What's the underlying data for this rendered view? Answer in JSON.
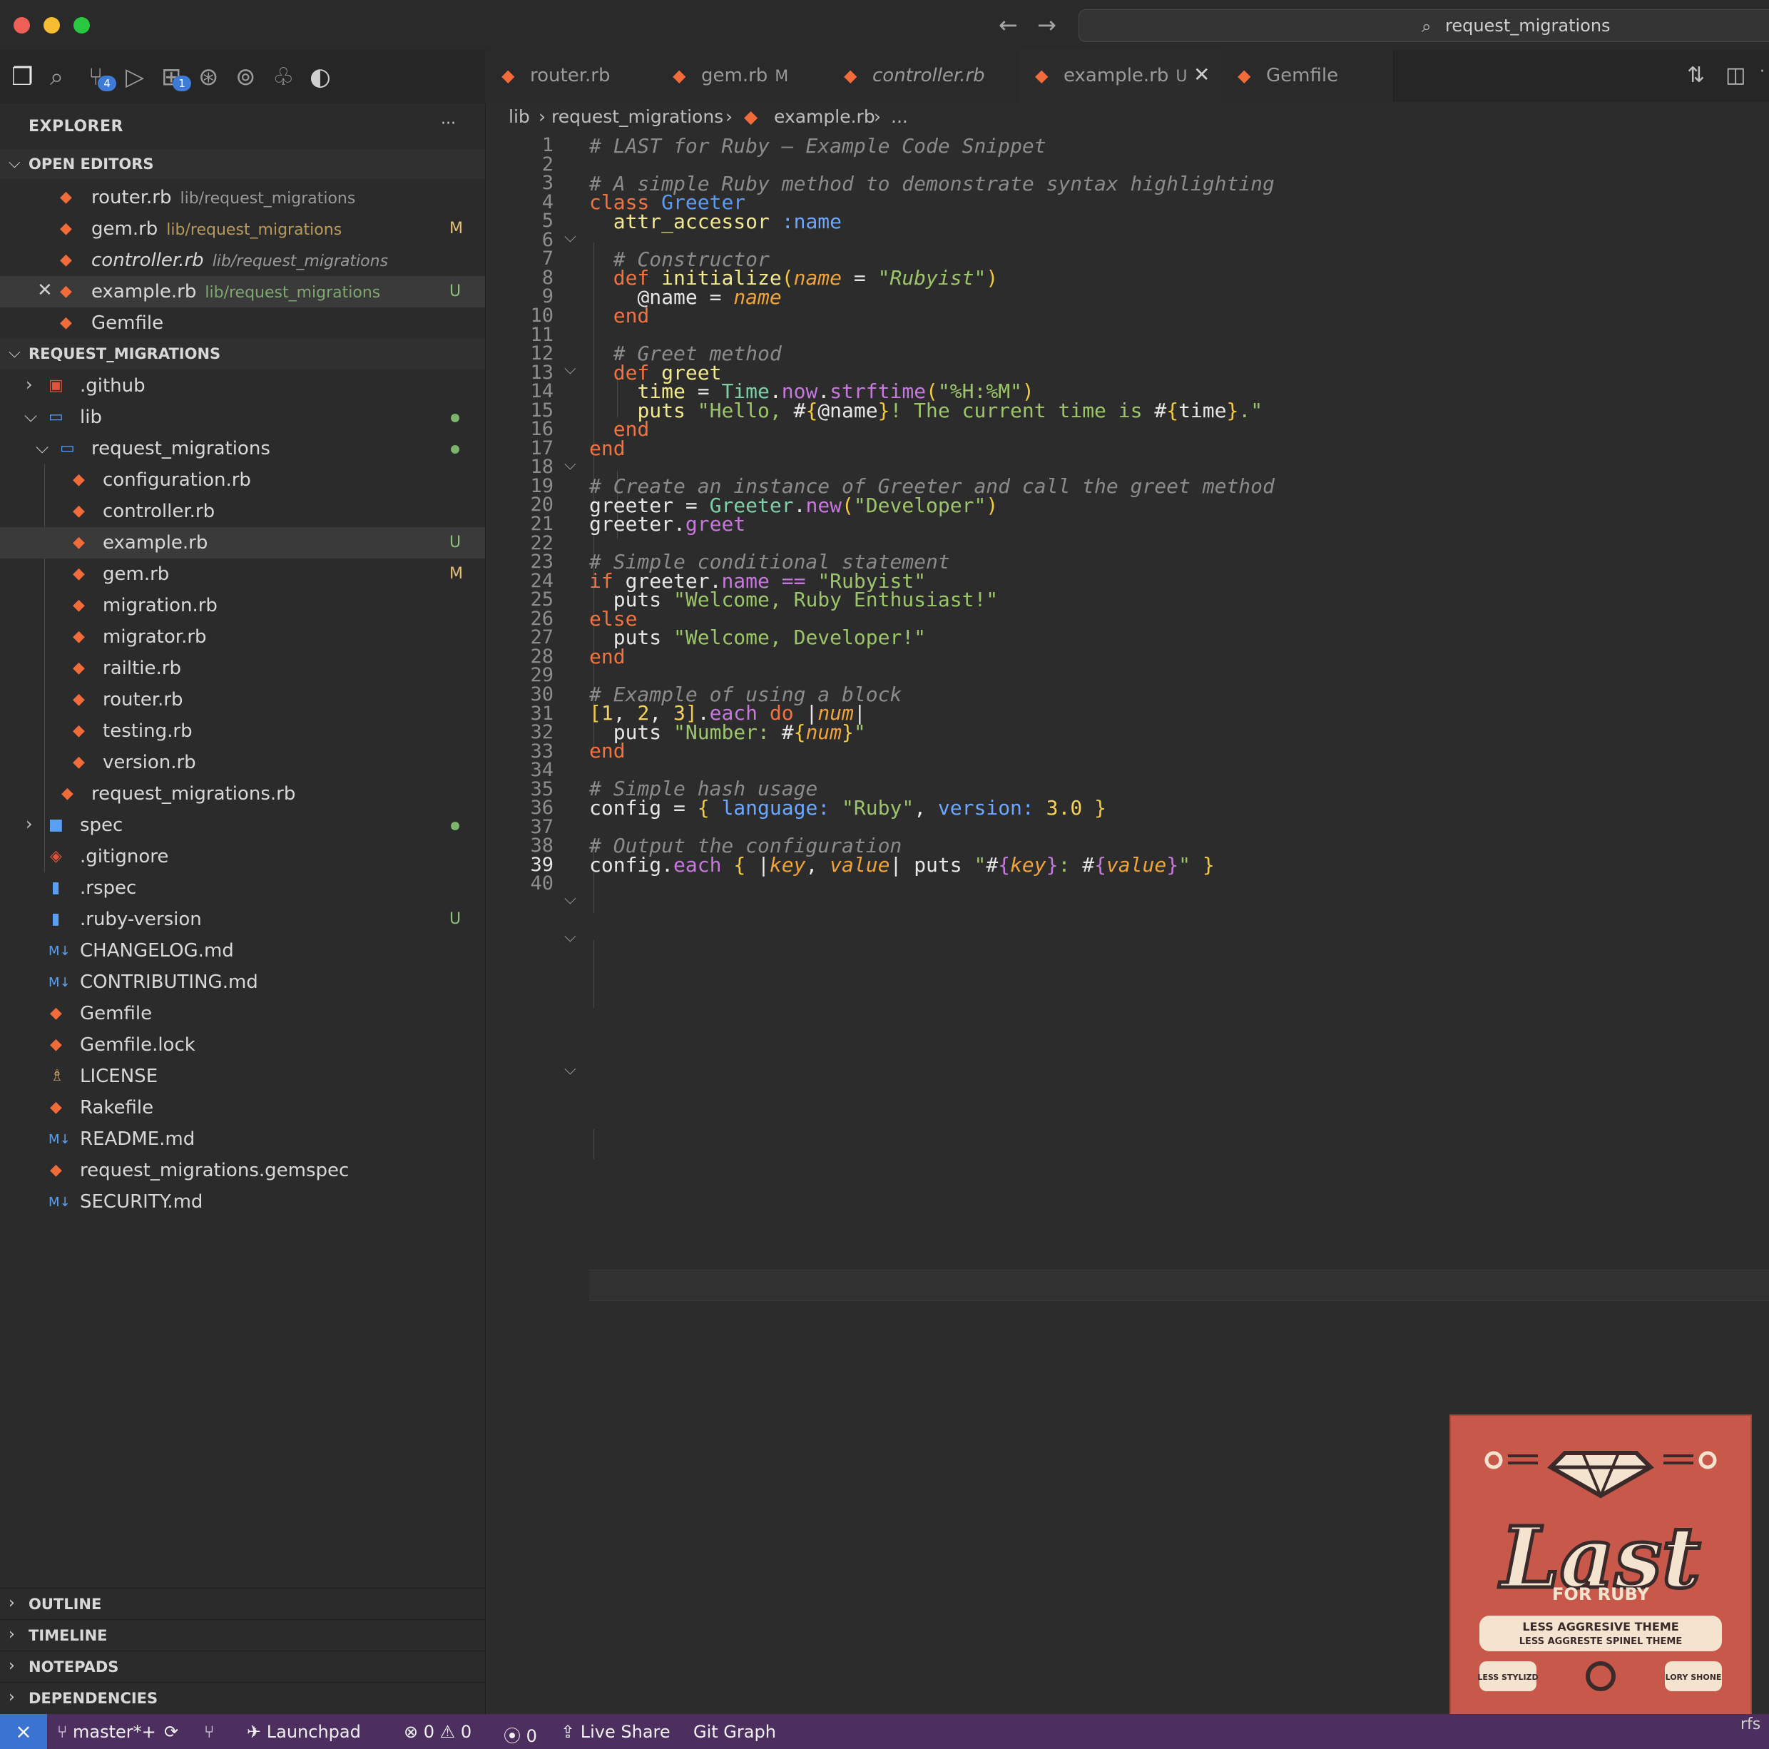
{
  "window": {
    "search_text": "request_migrations"
  },
  "activity": {
    "scm_badge": "4",
    "extensions_badge": "1"
  },
  "sidebar": {
    "title": "EXPLORER",
    "more": "···",
    "open_editors_title": "OPEN EDITORS",
    "open_editors": [
      {
        "name": "router.rb",
        "path": "lib/request_migrations",
        "status": ""
      },
      {
        "name": "gem.rb",
        "path": "lib/request_migrations",
        "status": "M"
      },
      {
        "name": "controller.rb",
        "path": "lib/request_migrations",
        "status": ""
      },
      {
        "name": "example.rb",
        "path": "lib/request_migrations",
        "status": "U"
      },
      {
        "name": "Gemfile",
        "path": "",
        "status": ""
      }
    ],
    "project_title": "REQUEST_MIGRATIONS",
    "tree": [
      {
        "name": ".github"
      },
      {
        "name": "lib"
      },
      {
        "name": "request_migrations"
      },
      {
        "name": "configuration.rb"
      },
      {
        "name": "controller.rb"
      },
      {
        "name": "example.rb",
        "status": "U"
      },
      {
        "name": "gem.rb",
        "status": "M"
      },
      {
        "name": "migration.rb"
      },
      {
        "name": "migrator.rb"
      },
      {
        "name": "railtie.rb"
      },
      {
        "name": "router.rb"
      },
      {
        "name": "testing.rb"
      },
      {
        "name": "version.rb"
      },
      {
        "name": "request_migrations.rb"
      },
      {
        "name": "spec"
      },
      {
        "name": ".gitignore"
      },
      {
        "name": ".rspec"
      },
      {
        "name": ".ruby-version",
        "status": "U"
      },
      {
        "name": "CHANGELOG.md"
      },
      {
        "name": "CONTRIBUTING.md"
      },
      {
        "name": "Gemfile"
      },
      {
        "name": "Gemfile.lock"
      },
      {
        "name": "LICENSE"
      },
      {
        "name": "Rakefile"
      },
      {
        "name": "README.md"
      },
      {
        "name": "request_migrations.gemspec"
      },
      {
        "name": "SECURITY.md"
      }
    ],
    "bottom_sections": [
      "OUTLINE",
      "TIMELINE",
      "NOTEPADS",
      "DEPENDENCIES"
    ]
  },
  "tabs": [
    {
      "label": "router.rb",
      "mark": ""
    },
    {
      "label": "gem.rb",
      "mark": "M"
    },
    {
      "label": "controller.rb",
      "mark": ""
    },
    {
      "label": "example.rb",
      "mark": "U"
    },
    {
      "label": "Gemfile",
      "mark": ""
    }
  ],
  "breadcrumb": [
    "lib",
    "request_migrations",
    "example.rb",
    "..."
  ],
  "editor": {
    "current_line": "39",
    "lines": [
      "1",
      "2",
      "3",
      "4",
      "5",
      "6",
      "7",
      "8",
      "9",
      "10",
      "11",
      "12",
      "13",
      "14",
      "15",
      "16",
      "17",
      "18",
      "19",
      "20",
      "21",
      "22",
      "23",
      "24",
      "25",
      "26",
      "27",
      "28",
      "29",
      "30",
      "31",
      "32",
      "33",
      "34",
      "35",
      "36",
      "37",
      "38",
      "39",
      "40"
    ],
    "code": {
      "l1": "# LAST for Ruby – Example Code Snippet",
      "l3": "# A simple Ruby method to demonstrate syntax highlighting",
      "l4a": "class",
      "l4b": "Greeter",
      "l5a": "attr_accessor",
      "l5b": ":name",
      "l7": "# Constructor",
      "l8a": "def",
      "l8b": "initialize",
      "l8c": "name",
      "l8d": "\"Rubyist\"",
      "l9a": "@name",
      "l9b": "name",
      "l10": "end",
      "l12": "# Greet method",
      "l13a": "def",
      "l13b": "greet",
      "l14a": "time",
      "l14b": "Time",
      "l14c": "now",
      "l14d": "strftime",
      "l14e": "\"%H:%M\"",
      "l15a": "puts",
      "l15b": "\"Hello, ",
      "l15c": "@name",
      "l15d": "! The current time is ",
      "l15e": "time",
      "l15f": ".\"",
      "l16": "end",
      "l17": "end",
      "l19": "# Create an instance of Greeter and call the greet method",
      "l20a": "greeter",
      "l20b": "Greeter",
      "l20c": "new",
      "l20d": "\"Developer\"",
      "l21a": "greeter",
      "l21b": "greet",
      "l23": "# Simple conditional statement",
      "l24a": "if",
      "l24b": "greeter",
      "l24c": "name",
      "l24d": "==",
      "l24e": "\"Rubyist\"",
      "l25a": "puts",
      "l25b": "\"Welcome, Ruby Enthusiast!\"",
      "l26": "else",
      "l27a": "puts",
      "l27b": "\"Welcome, Developer!\"",
      "l28": "end",
      "l30": "# Example of using a block",
      "l31a": "1",
      "l31b": "2",
      "l31c": "3",
      "l31d": "each",
      "l31e": "do",
      "l31f": "num",
      "l32a": "puts",
      "l32b": "\"Number: ",
      "l32c": "num",
      "l32d": "\"",
      "l33": "end",
      "l35": "# Simple hash usage",
      "l36a": "config",
      "l36b": "language:",
      "l36c": "\"Ruby\"",
      "l36d": "version:",
      "l36e": "3.0",
      "l38": "# Output the configuration",
      "l39a": "config",
      "l39b": "each",
      "l39c": "key",
      "l39d": "value",
      "l39e": "puts",
      "l39f": "key",
      "l39g": "value"
    }
  },
  "theme_card": {
    "title": "Last",
    "subtitle": "FOR RUBY",
    "tagline1": "LESS AGGRESIVE THEME",
    "tagline2": "LESS AGGRESTE SPINEL THEME",
    "chip_left": "LESS STYLIZD",
    "chip_right": "LORY SHONE"
  },
  "statusbar": {
    "branch": "master*+",
    "launchpad": "Launchpad",
    "errors": "0",
    "warnings": "0",
    "ports": "0",
    "live_share": "Live Share",
    "git_graph": "Git Graph",
    "edge_text": "rfs"
  },
  "colors": {
    "accent": "#3a73d1",
    "status_bg": "#4c2f5f",
    "ruby": "#f26b3a"
  }
}
